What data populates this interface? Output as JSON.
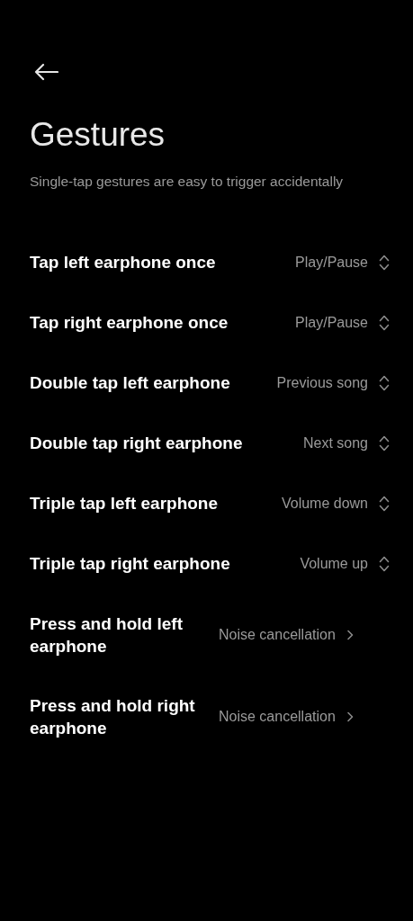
{
  "header": {
    "title": "Gestures",
    "subtitle": "Single-tap gestures are easy to trigger accidentally"
  },
  "rows": [
    {
      "label": "Tap left earphone once",
      "value": "Play/Pause",
      "kind": "select"
    },
    {
      "label": "Tap right earphone once",
      "value": "Play/Pause",
      "kind": "select"
    },
    {
      "label": "Double tap left earphone",
      "value": "Previous song",
      "kind": "select"
    },
    {
      "label": "Double tap right earphone",
      "value": "Next song",
      "kind": "select"
    },
    {
      "label": "Triple tap left earphone",
      "value": "Volume down",
      "kind": "select"
    },
    {
      "label": "Triple tap right earphone",
      "value": "Volume up",
      "kind": "select"
    },
    {
      "label": "Press and hold left earphone",
      "value": "Noise cancellation",
      "kind": "link"
    },
    {
      "label": "Press and hold right earphone",
      "value": "Noise cancellation",
      "kind": "link"
    }
  ]
}
